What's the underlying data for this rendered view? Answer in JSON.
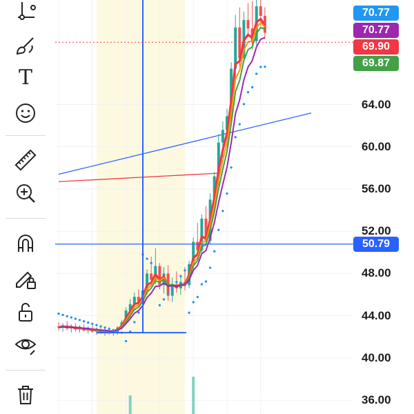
{
  "toolbar": {
    "tools": [
      {
        "name": "trend-line-tool",
        "icon": "trend-line-icon"
      },
      {
        "name": "brush-tool",
        "icon": "brush-icon"
      },
      {
        "name": "text-tool",
        "icon": "text-icon"
      },
      {
        "name": "emoji-tool",
        "icon": "smiley-icon"
      },
      {
        "name": "ruler-tool",
        "icon": "ruler-icon"
      },
      {
        "name": "zoom-in-tool",
        "icon": "zoom-in-icon"
      },
      {
        "name": "magnet-tool",
        "icon": "magnet-icon"
      },
      {
        "name": "lock-drawings-tool",
        "icon": "pencil-lock-icon"
      },
      {
        "name": "unlock-tool",
        "icon": "unlock-icon"
      },
      {
        "name": "hide-drawings-tool",
        "icon": "eye-icon"
      },
      {
        "name": "delete-tool",
        "icon": "trash-icon"
      }
    ],
    "text_tool_glyph": "T"
  },
  "price_scale": {
    "ticks": [
      "64.00",
      "60.00",
      "56.00",
      "52.00",
      "48.00",
      "44.00",
      "40.00",
      "36.00"
    ]
  },
  "price_badges": [
    {
      "value": "70.77",
      "color": "#2196f3"
    },
    {
      "value": "70.77",
      "color": "#9c27b0"
    },
    {
      "value": "69.90",
      "color": "#f23645"
    },
    {
      "value": "69.87",
      "color": "#43a047"
    }
  ],
  "horizontal_line_badge": {
    "value": "50.79",
    "color": "#2962ff"
  },
  "chart_data": {
    "type": "candlestick",
    "y_axis": {
      "min": 34.7,
      "max": 73.9,
      "ticks": [
        64,
        60,
        56,
        52,
        48,
        44,
        40,
        36
      ]
    },
    "candles": [
      [
        43.0,
        43.4,
        42.6,
        42.9
      ],
      [
        42.9,
        43.3,
        42.5,
        43.1
      ],
      [
        43.1,
        43.5,
        42.6,
        42.8
      ],
      [
        42.8,
        43.2,
        42.4,
        43.0
      ],
      [
        43.0,
        43.3,
        42.5,
        42.7
      ],
      [
        42.7,
        43.1,
        42.4,
        42.9
      ],
      [
        42.9,
        43.2,
        42.5,
        42.6
      ],
      [
        42.6,
        43.0,
        42.3,
        42.8
      ],
      [
        42.8,
        43.1,
        42.4,
        42.5
      ],
      [
        42.5,
        42.9,
        42.2,
        42.7
      ],
      [
        42.7,
        43.0,
        42.3,
        42.4
      ],
      [
        42.4,
        42.8,
        42.1,
        42.6
      ],
      [
        42.6,
        42.9,
        42.2,
        42.4
      ],
      [
        42.4,
        42.7,
        42.1,
        42.5
      ],
      [
        42.5,
        43.0,
        42.2,
        42.9
      ],
      [
        42.9,
        43.6,
        42.7,
        43.4
      ],
      [
        43.4,
        44.8,
        43.2,
        44.5
      ],
      [
        44.5,
        45.6,
        43.8,
        45.1
      ],
      [
        45.1,
        46.2,
        44.6,
        45.8
      ],
      [
        45.8,
        46.5,
        44.9,
        45.3
      ],
      [
        45.3,
        46.7,
        45.0,
        46.4
      ],
      [
        46.4,
        48.4,
        46.0,
        48.0
      ],
      [
        48.0,
        49.6,
        46.8,
        47.4
      ],
      [
        47.4,
        50.4,
        47.0,
        48.7
      ],
      [
        48.7,
        49.0,
        46.5,
        46.9
      ],
      [
        46.9,
        48.6,
        46.1,
        48.0
      ],
      [
        48.0,
        48.8,
        45.4,
        45.9
      ],
      [
        45.9,
        47.6,
        45.3,
        47.0
      ],
      [
        47.0,
        48.2,
        46.2,
        46.6
      ],
      [
        46.6,
        47.8,
        46.0,
        47.2
      ],
      [
        47.2,
        48.6,
        46.4,
        46.9
      ],
      [
        46.9,
        49.2,
        46.6,
        48.9
      ],
      [
        48.9,
        51.4,
        48.4,
        51.0
      ],
      [
        51.0,
        52.8,
        49.4,
        50.2
      ],
      [
        50.2,
        53.6,
        49.8,
        53.2
      ],
      [
        53.2,
        54.4,
        50.6,
        51.1
      ],
      [
        51.1,
        55.6,
        50.8,
        55.0
      ],
      [
        55.0,
        57.6,
        54.6,
        57.2
      ],
      [
        57.2,
        61.2,
        56.4,
        60.4
      ],
      [
        60.4,
        62.4,
        59.0,
        61.6
      ],
      [
        61.6,
        63.6,
        60.2,
        62.9
      ],
      [
        62.9,
        68.0,
        62.2,
        67.4
      ],
      [
        67.4,
        72.5,
        66.0,
        71.3
      ],
      [
        71.3,
        73.2,
        67.6,
        68.4
      ],
      [
        68.4,
        72.8,
        68.0,
        72.0
      ],
      [
        72.0,
        73.6,
        70.4,
        71.2
      ],
      [
        71.2,
        73.8,
        69.2,
        70.0
      ],
      [
        70.0,
        73.9,
        69.6,
        73.3
      ],
      [
        73.3,
        73.9,
        71.4,
        72.4
      ],
      [
        72.4,
        73.2,
        70.2,
        70.8
      ]
    ],
    "volume": [
      0,
      0,
      0,
      0,
      0,
      0,
      0,
      0,
      0,
      0,
      0,
      0,
      0,
      0,
      0,
      0,
      0,
      0,
      0,
      0,
      0,
      0,
      0,
      0,
      0,
      0,
      0,
      0,
      0,
      0,
      0,
      0,
      0,
      0,
      0,
      0,
      0,
      0,
      0,
      0,
      0,
      0,
      0,
      0,
      0,
      0,
      0,
      0,
      0,
      0
    ],
    "volume_bars": [
      {
        "index": 17,
        "value": 1.5
      },
      {
        "index": 32,
        "value": 3.0
      }
    ],
    "moving_averages": [
      {
        "name": "",
        "color": "#f23645"
      },
      {
        "name": "",
        "color": "#ff9800"
      },
      {
        "name": "",
        "color": "#43a047"
      },
      {
        "name": "",
        "color": "#9c27b0"
      }
    ],
    "parabolic_sar": {
      "color": "#2196f3"
    },
    "drawings": {
      "highlight_band": {
        "from_index": 9,
        "to_index": 30
      },
      "vertical_line_index": 20,
      "horizontal_line_value": 50.79,
      "vertical_line_bottom_value": 42.4,
      "trend_lines": [
        {
          "color": "#2962ff",
          "from": [
            0,
            57.4
          ],
          "to": [
            60,
            63.2
          ]
        },
        {
          "color": "#f23645",
          "from": [
            0,
            56.7
          ],
          "to": [
            38,
            57.5
          ]
        }
      ],
      "dotted_price_line_value": 69.9
    },
    "grid": true
  }
}
